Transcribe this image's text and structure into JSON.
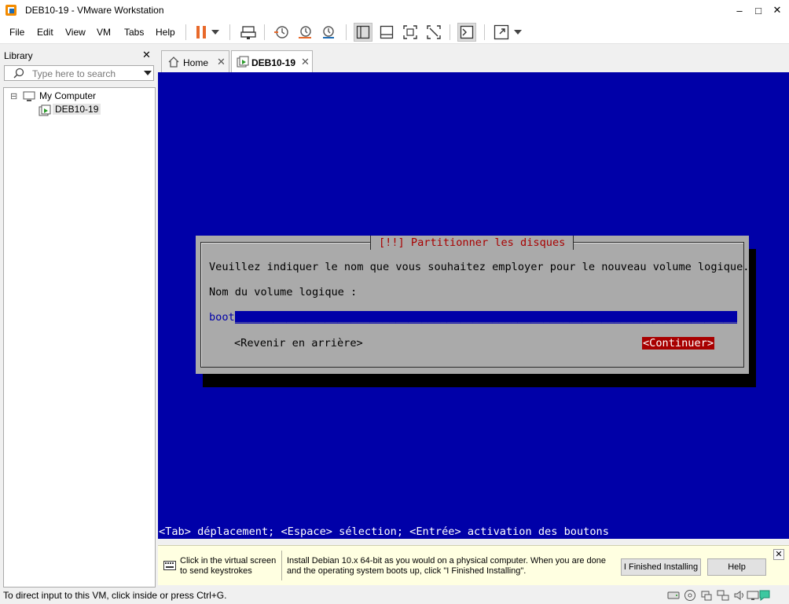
{
  "window": {
    "title": "DEB10-19 - VMware Workstation",
    "minimize": "–",
    "maximize": "□",
    "close": "✕"
  },
  "menu": [
    "File",
    "Edit",
    "View",
    "VM",
    "Tabs",
    "Help"
  ],
  "toolbar_icons": [
    "pause-icon",
    "send-ctrl-alt-del-icon",
    "snapshot-icon",
    "revert-snapshot-icon",
    "snapshot-manager-icon",
    "library-view-icon",
    "thumbnail-bar-icon",
    "full-screen-icon",
    "unity-icon",
    "console-view-icon",
    "stretch-guest-icon"
  ],
  "library": {
    "title": "Library",
    "close": "✕",
    "search_placeholder": "Type here to search",
    "tree": {
      "root": "My Computer",
      "root_toggle": "⊟",
      "children": [
        "DEB10-19"
      ]
    }
  },
  "tabs": [
    {
      "label": "Home",
      "close": "✕",
      "active": false
    },
    {
      "label": "DEB10-19",
      "close": "✕",
      "active": true
    }
  ],
  "installer": {
    "dialog_title": "[!!] Partitionner les disques",
    "prompt": "Veuillez indiquer le nom que vous souhaitez employer pour le nouveau volume logique.",
    "field_label": "Nom du volume logique :",
    "field_value": "boot",
    "back_button": "<Revenir en arrière>",
    "continue_button": "<Continuer>",
    "hint": "<Tab> déplacement; <Espace> sélection; <Entrée> activation des boutons"
  },
  "tip": {
    "keyboard_text": "Click in the virtual screen to send keystrokes",
    "install_text": "Install Debian 10.x 64-bit as you would on a physical computer. When you are done and the operating system boots up, click \"I Finished Installing\".",
    "finished_button": "I Finished Installing",
    "help_button": "Help",
    "close": "✕"
  },
  "status": {
    "text": "To direct input to this VM, click inside or press Ctrl+G.",
    "icons": [
      "hard-disk-icon",
      "cdrom-icon",
      "usb-icon",
      "network-icon",
      "sound-icon",
      "display-icon",
      "message-icon"
    ]
  },
  "colors": {
    "vm_background": "#0000a8",
    "dialog_gray": "#aaaaaa",
    "dialog_title_red": "#a80000",
    "pause_orange": "#e8692a"
  }
}
